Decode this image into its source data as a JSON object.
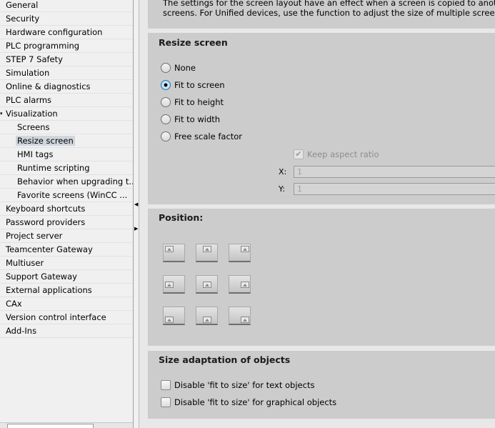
{
  "tree": {
    "items": [
      {
        "label": "General",
        "level": 0
      },
      {
        "label": "Security",
        "level": 0
      },
      {
        "label": "Hardware configuration",
        "level": 0
      },
      {
        "label": "PLC programming",
        "level": 0
      },
      {
        "label": "STEP 7 Safety",
        "level": 0
      },
      {
        "label": "Simulation",
        "level": 0
      },
      {
        "label": "Online & diagnostics",
        "level": 0
      },
      {
        "label": "PLC alarms",
        "level": 0
      },
      {
        "label": "Visualization",
        "level": 0,
        "expanded": true
      },
      {
        "label": "Screens",
        "level": 1
      },
      {
        "label": "Resize screen",
        "level": 1,
        "selected": true
      },
      {
        "label": "HMI tags",
        "level": 1
      },
      {
        "label": "Runtime scripting",
        "level": 1
      },
      {
        "label": "Behavior when upgrading t...",
        "level": 1
      },
      {
        "label": "Favorite screens (WinCC ...",
        "level": 1
      },
      {
        "label": "Keyboard shortcuts",
        "level": 0
      },
      {
        "label": "Password providers",
        "level": 0
      },
      {
        "label": "Project server",
        "level": 0
      },
      {
        "label": "Teamcenter Gateway",
        "level": 0
      },
      {
        "label": "Multiuser",
        "level": 0
      },
      {
        "label": "Support Gateway",
        "level": 0
      },
      {
        "label": "External applications",
        "level": 0
      },
      {
        "label": "CAx",
        "level": 0
      },
      {
        "label": "Version control interface",
        "level": 0
      },
      {
        "label": "Add-Ins",
        "level": 0
      }
    ]
  },
  "info": {
    "line1": "The settings for the screen layout have an effect when a screen is copied to another d",
    "line2": "screens. For Unified devices, use the function to adjust the size of multiple screens."
  },
  "resize": {
    "title": "Resize screen",
    "options": [
      "None",
      "Fit to screen",
      "Fit to height",
      "Fit to width",
      "Free scale factor"
    ],
    "selected": "Fit to screen",
    "keep_aspect_label": "Keep aspect ratio",
    "keep_aspect_checked": true,
    "x_label": "X:",
    "x_value": "1",
    "y_label": "Y:",
    "y_value": "1"
  },
  "position": {
    "title": "Position:",
    "buttons": [
      "top-left",
      "top-center",
      "top-right",
      "middle-left",
      "center",
      "middle-right",
      "bottom-left",
      "bottom-center",
      "bottom-right"
    ]
  },
  "size_adaptation": {
    "title": "Size adaptation of objects",
    "options": [
      {
        "label": "Disable 'fit to size' for text objects",
        "checked": false
      },
      {
        "label": "Disable 'fit to size' for graphical objects",
        "checked": false
      }
    ]
  },
  "colors": {
    "panel": "#cccccc",
    "selection": "#cfd6dd",
    "radio_accent": "#2a7ab0"
  }
}
